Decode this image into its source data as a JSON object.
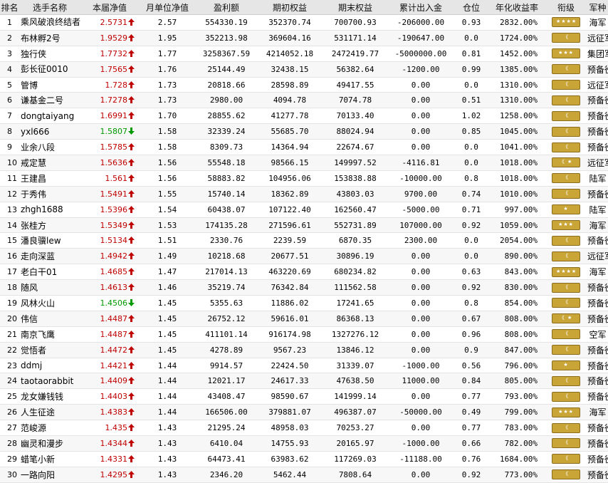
{
  "headers": [
    "排名",
    "选手名称",
    "本届净值",
    "月单位净值",
    "盈利额",
    "期初权益",
    "期末权益",
    "累计出入金",
    "仓位",
    "年化收益率",
    "衔级",
    "军种"
  ],
  "rows": [
    {
      "rank": "1",
      "name": "乘风破浪终结者",
      "nav": "2.5731",
      "dir": "up",
      "monthly": "2.57",
      "profit": "554330.19",
      "start": "352370.74",
      "end": "700700.93",
      "flow": "-206000.00",
      "pos": "0.93",
      "annual": "2832.00%",
      "badge": "stars-4",
      "branch": "海军"
    },
    {
      "rank": "2",
      "name": "布林孵2号",
      "nav": "1.9529",
      "dir": "up",
      "monthly": "1.95",
      "profit": "352213.98",
      "start": "369604.16",
      "end": "531171.14",
      "flow": "-190647.00",
      "pos": "0.0",
      "annual": "1724.00%",
      "badge": "chevron",
      "branch": "远征军"
    },
    {
      "rank": "3",
      "name": "独行侠",
      "nav": "1.7732",
      "dir": "up",
      "monthly": "1.77",
      "profit": "3258367.59",
      "start": "4214052.18",
      "end": "2472419.77",
      "flow": "-5000000.00",
      "pos": "0.81",
      "annual": "1452.00%",
      "badge": "stars-3",
      "branch": "集团军"
    },
    {
      "rank": "4",
      "name": "彭长征0010",
      "nav": "1.7565",
      "dir": "up",
      "monthly": "1.76",
      "profit": "25144.49",
      "start": "32438.15",
      "end": "56382.64",
      "flow": "-1200.00",
      "pos": "0.99",
      "annual": "1385.00%",
      "badge": "chevron",
      "branch": "预备役"
    },
    {
      "rank": "5",
      "name": "管博",
      "nav": "1.728",
      "dir": "up",
      "monthly": "1.73",
      "profit": "20818.66",
      "start": "28598.89",
      "end": "49417.55",
      "flow": "0.00",
      "pos": "0.0",
      "annual": "1310.00%",
      "badge": "chevron",
      "branch": "远征军"
    },
    {
      "rank": "6",
      "name": "谦基金二号",
      "nav": "1.7278",
      "dir": "up",
      "monthly": "1.73",
      "profit": "2980.00",
      "start": "4094.78",
      "end": "7074.78",
      "flow": "0.00",
      "pos": "0.51",
      "annual": "1310.00%",
      "badge": "chevron",
      "branch": "预备役"
    },
    {
      "rank": "7",
      "name": "dongtaiyang",
      "nav": "1.6991",
      "dir": "up",
      "monthly": "1.70",
      "profit": "28855.62",
      "start": "41277.78",
      "end": "70133.40",
      "flow": "0.00",
      "pos": "1.02",
      "annual": "1258.00%",
      "badge": "chevron",
      "branch": "预备役"
    },
    {
      "rank": "8",
      "name": "yxl666",
      "nav": "1.5807",
      "dir": "down",
      "monthly": "1.58",
      "profit": "32339.24",
      "start": "55685.70",
      "end": "88024.94",
      "flow": "0.00",
      "pos": "0.85",
      "annual": "1045.00%",
      "badge": "chevron",
      "branch": "预备役"
    },
    {
      "rank": "9",
      "name": "业余八段",
      "nav": "1.5785",
      "dir": "up",
      "monthly": "1.58",
      "profit": "8309.73",
      "start": "14364.94",
      "end": "22674.67",
      "flow": "0.00",
      "pos": "0.0",
      "annual": "1041.00%",
      "badge": "chevron",
      "branch": "预备役"
    },
    {
      "rank": "10",
      "name": "戒定慧",
      "nav": "1.5636",
      "dir": "up",
      "monthly": "1.56",
      "profit": "55548.18",
      "start": "98566.15",
      "end": "149997.52",
      "flow": "-4116.81",
      "pos": "0.0",
      "annual": "1018.00%",
      "badge": "chev-star",
      "branch": "远征军"
    },
    {
      "rank": "11",
      "name": "王建昌",
      "nav": "1.561",
      "dir": "up",
      "monthly": "1.56",
      "profit": "58883.82",
      "start": "104956.06",
      "end": "153838.88",
      "flow": "-10000.00",
      "pos": "0.8",
      "annual": "1018.00%",
      "badge": "chevron",
      "branch": "陆军"
    },
    {
      "rank": "12",
      "name": "于秀伟",
      "nav": "1.5491",
      "dir": "up",
      "monthly": "1.55",
      "profit": "15740.14",
      "start": "18362.89",
      "end": "43803.03",
      "flow": "9700.00",
      "pos": "0.74",
      "annual": "1010.00%",
      "badge": "chevron",
      "branch": "预备役"
    },
    {
      "rank": "13",
      "name": "zhgh1688",
      "nav": "1.5396",
      "dir": "up",
      "monthly": "1.54",
      "profit": "60438.07",
      "start": "107122.40",
      "end": "162560.47",
      "flow": "-5000.00",
      "pos": "0.71",
      "annual": "997.00%",
      "badge": "star-1",
      "branch": "陆军"
    },
    {
      "rank": "14",
      "name": "张桂方",
      "nav": "1.5349",
      "dir": "up",
      "monthly": "1.53",
      "profit": "174135.28",
      "start": "271596.61",
      "end": "552731.89",
      "flow": "107000.00",
      "pos": "0.92",
      "annual": "1059.00%",
      "badge": "stars-3",
      "branch": "海军"
    },
    {
      "rank": "15",
      "name": "潘良骥lew",
      "nav": "1.5134",
      "dir": "up",
      "monthly": "1.51",
      "profit": "2330.76",
      "start": "2239.59",
      "end": "6870.35",
      "flow": "2300.00",
      "pos": "0.0",
      "annual": "2054.00%",
      "badge": "chevron",
      "branch": "预备役"
    },
    {
      "rank": "16",
      "name": "走向深蓝",
      "nav": "1.4942",
      "dir": "up",
      "monthly": "1.49",
      "profit": "10218.68",
      "start": "20677.51",
      "end": "30896.19",
      "flow": "0.00",
      "pos": "0.0",
      "annual": "890.00%",
      "badge": "chevron",
      "branch": "远征军"
    },
    {
      "rank": "17",
      "name": "老白干01",
      "nav": "1.4685",
      "dir": "up",
      "monthly": "1.47",
      "profit": "217014.13",
      "start": "463220.69",
      "end": "680234.82",
      "flow": "0.00",
      "pos": "0.63",
      "annual": "843.00%",
      "badge": "stars-4",
      "branch": "海军"
    },
    {
      "rank": "18",
      "name": "随风",
      "nav": "1.4613",
      "dir": "up",
      "monthly": "1.46",
      "profit": "35219.74",
      "start": "76342.84",
      "end": "111562.58",
      "flow": "0.00",
      "pos": "0.92",
      "annual": "830.00%",
      "badge": "chevron",
      "branch": "预备役"
    },
    {
      "rank": "19",
      "name": "风林火山",
      "nav": "1.4506",
      "dir": "down",
      "monthly": "1.45",
      "profit": "5355.63",
      "start": "11886.02",
      "end": "17241.65",
      "flow": "0.00",
      "pos": "0.8",
      "annual": "854.00%",
      "badge": "chevron",
      "branch": "预备役"
    },
    {
      "rank": "20",
      "name": "伟信",
      "nav": "1.4487",
      "dir": "up",
      "monthly": "1.45",
      "profit": "26752.12",
      "start": "59616.01",
      "end": "86368.13",
      "flow": "0.00",
      "pos": "0.67",
      "annual": "808.00%",
      "badge": "chev-star",
      "branch": "预备役"
    },
    {
      "rank": "21",
      "name": "南京飞鹰",
      "nav": "1.4487",
      "dir": "up",
      "monthly": "1.45",
      "profit": "411101.14",
      "start": "916174.98",
      "end": "1327276.12",
      "flow": "0.00",
      "pos": "0.96",
      "annual": "808.00%",
      "badge": "chevron",
      "branch": "空军"
    },
    {
      "rank": "22",
      "name": "觉悟者",
      "nav": "1.4472",
      "dir": "up",
      "monthly": "1.45",
      "profit": "4278.89",
      "start": "9567.23",
      "end": "13846.12",
      "flow": "0.00",
      "pos": "0.9",
      "annual": "847.00%",
      "badge": "chevron",
      "branch": "预备役"
    },
    {
      "rank": "23",
      "name": "ddmj",
      "nav": "1.4421",
      "dir": "up",
      "monthly": "1.44",
      "profit": "9914.57",
      "start": "22424.50",
      "end": "31339.07",
      "flow": "-1000.00",
      "pos": "0.56",
      "annual": "796.00%",
      "badge": "star-1",
      "branch": "预备役"
    },
    {
      "rank": "24",
      "name": "taotaorabbit",
      "nav": "1.4409",
      "dir": "up",
      "monthly": "1.44",
      "profit": "12021.17",
      "start": "24617.33",
      "end": "47638.50",
      "flow": "11000.00",
      "pos": "0.84",
      "annual": "805.00%",
      "badge": "chevron",
      "branch": "预备役"
    },
    {
      "rank": "25",
      "name": "龙女嫌钱钱",
      "nav": "1.4403",
      "dir": "up",
      "monthly": "1.44",
      "profit": "43408.47",
      "start": "98590.67",
      "end": "141999.14",
      "flow": "0.00",
      "pos": "0.77",
      "annual": "793.00%",
      "badge": "chevron",
      "branch": "预备役"
    },
    {
      "rank": "26",
      "name": "人生征途",
      "nav": "1.4383",
      "dir": "up",
      "monthly": "1.44",
      "profit": "166506.00",
      "start": "379881.07",
      "end": "496387.07",
      "flow": "-50000.00",
      "pos": "0.49",
      "annual": "799.00%",
      "badge": "stars-3",
      "branch": "海军"
    },
    {
      "rank": "27",
      "name": "范峻源",
      "nav": "1.435",
      "dir": "up",
      "monthly": "1.43",
      "profit": "21295.24",
      "start": "48958.03",
      "end": "70253.27",
      "flow": "0.00",
      "pos": "0.77",
      "annual": "783.00%",
      "badge": "chevron",
      "branch": "预备役"
    },
    {
      "rank": "28",
      "name": "幽灵和漫步",
      "nav": "1.4344",
      "dir": "up",
      "monthly": "1.43",
      "profit": "6410.04",
      "start": "14755.93",
      "end": "20165.97",
      "flow": "-1000.00",
      "pos": "0.66",
      "annual": "782.00%",
      "badge": "chevron",
      "branch": "预备役"
    },
    {
      "rank": "29",
      "name": "蜡笔小新",
      "nav": "1.4331",
      "dir": "up",
      "monthly": "1.43",
      "profit": "64473.41",
      "start": "63983.62",
      "end": "117269.03",
      "flow": "-11188.00",
      "pos": "0.76",
      "annual": "1684.00%",
      "badge": "chevron",
      "branch": "预备役"
    },
    {
      "rank": "30",
      "name": "一路向阳",
      "nav": "1.4295",
      "dir": "up",
      "monthly": "1.43",
      "profit": "2346.20",
      "start": "5462.44",
      "end": "7808.64",
      "flow": "0.00",
      "pos": "0.92",
      "annual": "773.00%",
      "badge": "chevron",
      "branch": "预备役"
    }
  ],
  "colors": {
    "up": "#c00000",
    "down": "#009900",
    "badge": "#c9a437",
    "header_bg": "#e6e6e6"
  }
}
